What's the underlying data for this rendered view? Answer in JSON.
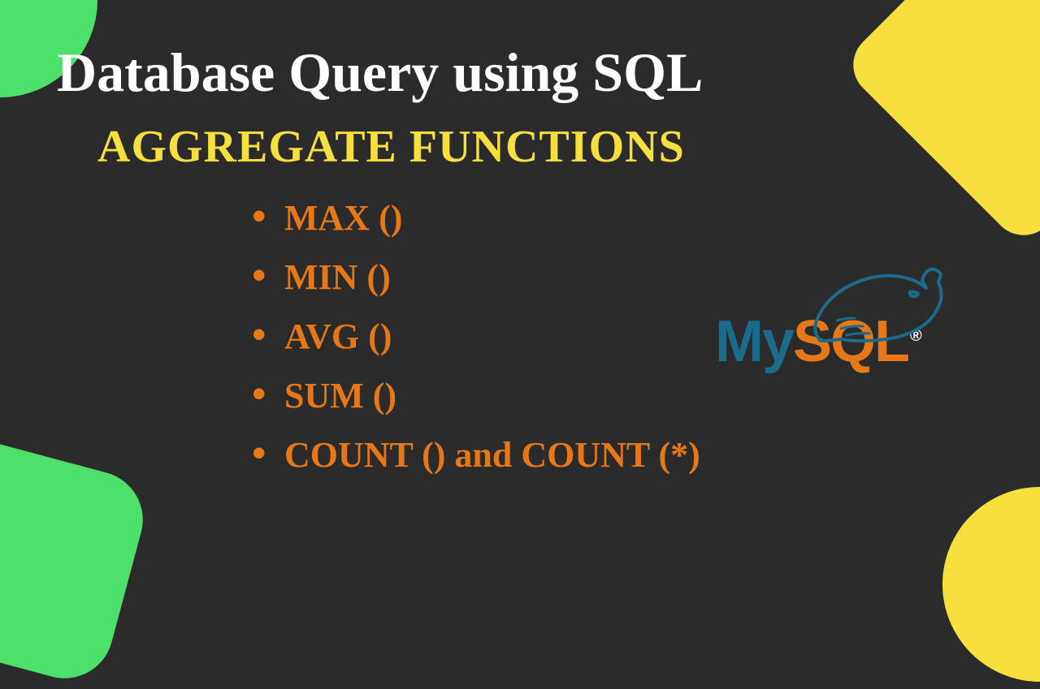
{
  "title": "Database Query using SQL",
  "subtitle": "AGGREGATE FUNCTIONS",
  "functions": [
    "MAX ()",
    "MIN ()",
    "AVG ()",
    "SUM ()",
    "COUNT () and COUNT (*)"
  ],
  "logo": {
    "part1": "My",
    "part2": "SQL",
    "registered": "®"
  },
  "colors": {
    "background": "#2b2b2b",
    "accent_green": "#4de06a",
    "accent_yellow": "#f7df3e",
    "accent_orange": "#e67817",
    "mysql_blue": "#1a6b8c",
    "text_white": "#ffffff"
  }
}
